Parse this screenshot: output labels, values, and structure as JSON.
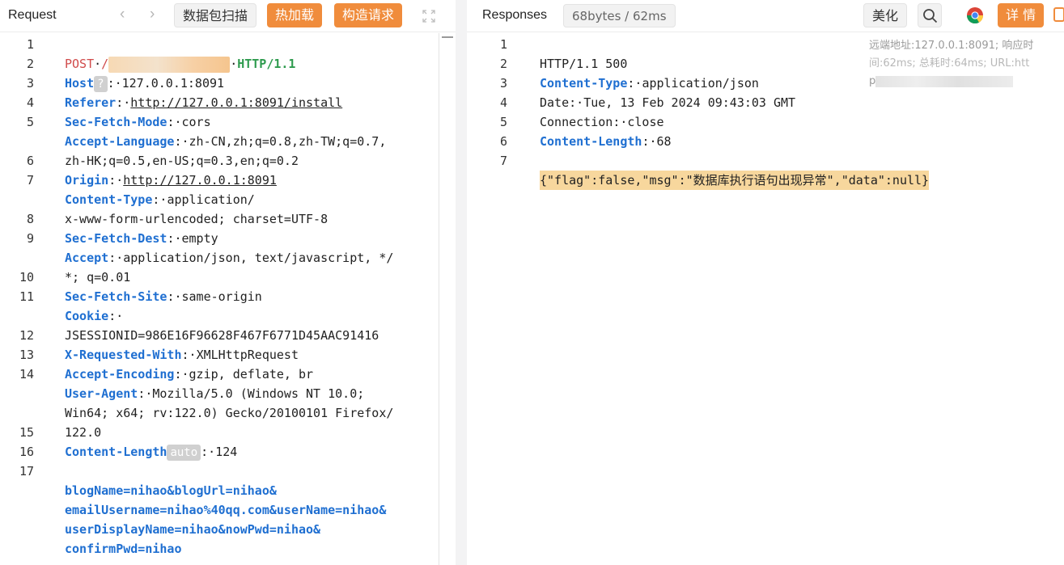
{
  "request": {
    "title": "Request",
    "nav_back": "‹",
    "nav_forward": "›",
    "btn_scan": "数据包扫描",
    "btn_hotload": "热加载",
    "btn_construct": "构造请求",
    "lines": [
      {
        "n": "1",
        "row": 0
      },
      {
        "n": "2",
        "row": 1
      },
      {
        "n": "3",
        "row": 2
      },
      {
        "n": "4",
        "row": 3
      },
      {
        "n": "5",
        "row": 4
      },
      {
        "n": "6",
        "row": 6
      },
      {
        "n": "7",
        "row": 7
      },
      {
        "n": "8",
        "row": 9
      },
      {
        "n": "9",
        "row": 10
      },
      {
        "n": "10",
        "row": 12
      },
      {
        "n": "11",
        "row": 13
      },
      {
        "n": "12",
        "row": 15
      },
      {
        "n": "13",
        "row": 16
      },
      {
        "n": "14",
        "row": 17
      },
      {
        "n": "15",
        "row": 20
      },
      {
        "n": "16",
        "row": 21
      },
      {
        "n": "17",
        "row": 22
      }
    ],
    "method": "POST",
    "path": "/",
    "protocol": "HTTP/1.1",
    "host_key": "Host",
    "host_badge": "?",
    "host_val": "127.0.0.1:8091",
    "referer_key": "Referer",
    "referer_val": "http://127.0.0.1:8091/install",
    "sec_mode_key": "Sec-Fetch-Mode",
    "sec_mode_val": "cors",
    "accept_lang_key": "Accept-Language",
    "accept_lang_val1": "zh-CN,zh;q=0.8,zh-TW;q=0.7,",
    "accept_lang_val2": "zh-HK;q=0.5,en-US;q=0.3,en;q=0.2",
    "origin_key": "Origin",
    "origin_val": "http://127.0.0.1:8091",
    "ctype_key": "Content-Type",
    "ctype_val1": "application/",
    "ctype_val2": "x-www-form-urlencoded; charset=UTF-8",
    "sec_dest_key": "Sec-Fetch-Dest",
    "sec_dest_val": "empty",
    "accept_key": "Accept",
    "accept_val1": "application/json, text/javascript, */",
    "accept_val2": "*; q=0.01",
    "sec_site_key": "Sec-Fetch-Site",
    "sec_site_val": "same-origin",
    "cookie_key": "Cookie",
    "cookie_val": "JSESSIONID=986E16F96628F467F6771D45AAC91416",
    "xrw_key": "X-Requested-With",
    "xrw_val": "XMLHttpRequest",
    "enc_key": "Accept-Encoding",
    "enc_val": "gzip, deflate, br",
    "ua_key": "User-Agent",
    "ua_val1": "Mozilla/5.0 (Windows NT 10.0;",
    "ua_val2": "Win64; x64; rv:122.0) Gecko/20100101 Firefox/",
    "ua_val3": "122.0",
    "clen_key": "Content-Length",
    "clen_badge": "auto",
    "clen_val": "124",
    "body1": "blogName=nihao&blogUrl=nihao&",
    "body2": "emailUsername=nihao%40qq.com&userName=nihao&",
    "body3": "userDisplayName=nihao&nowPwd=nihao&",
    "body4": "confirmPwd=nihao"
  },
  "response": {
    "title": "Responses",
    "stats": "68bytes / 62ms",
    "btn_beautify": "美化",
    "btn_details": "详 情",
    "lines": [
      {
        "n": "1",
        "row": 0
      },
      {
        "n": "2",
        "row": 1
      },
      {
        "n": "3",
        "row": 2
      },
      {
        "n": "4",
        "row": 3
      },
      {
        "n": "5",
        "row": 4
      },
      {
        "n": "6",
        "row": 5
      },
      {
        "n": "7",
        "row": 6
      }
    ],
    "status_line": "HTTP/1.1 500",
    "ctype_key": "Content-Type",
    "ctype_val": "application/json",
    "date_key": "Date",
    "date_val": "Tue, 13 Feb 2024 09:43:03 GMT",
    "conn_key": "Connection",
    "conn_val": "close",
    "clen_key": "Content-Length",
    "clen_val": "68",
    "body": "{\"flag\":false,\"msg\":\"数据库执行语句出现异常\",\"data\":null}",
    "info_line1": "远端地址:127.0.0.1:8091; 响应时",
    "info_line2": "间:62ms; 总耗时:64ms; URL:htt",
    "info_line3": "p"
  },
  "colors": {
    "accent_orange": "#f08c3c",
    "key_blue": "#1f6fd1",
    "method_red": "#d04a4a",
    "protocol_green": "#2e9b4e"
  }
}
